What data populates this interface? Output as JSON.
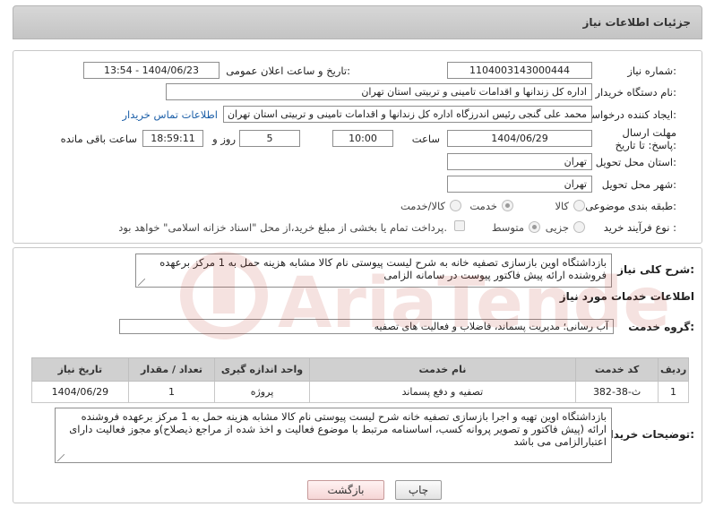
{
  "header": {
    "title": "جزئیات اطلاعات نیاز"
  },
  "form": {
    "need_number_label": "شماره نیاز:",
    "need_number": "1104003143000444",
    "announce_label": "تاریخ و ساعت اعلان عمومی:",
    "announce_value": "1404/06/23 - 13:54",
    "buyer_org_label": "نام دستگاه خریدار:",
    "buyer_org": "اداره کل زندانها و اقدامات تامینی و تربیتی استان تهران",
    "creator_label": "ایجاد کننده درخواست:",
    "creator": "محمد علی گنجی رئیس اندرزگاه  اداره کل زندانها و اقدامات تامینی و تربیتی استان تهران",
    "contact_link": "اطلاعات تماس خریدار",
    "deadline_label": "مهلت ارسال پاسخ: تا تاریخ:",
    "deadline_date": "1404/06/29",
    "time_label": "ساعت",
    "deadline_time": "10:00",
    "days_value": "5",
    "days_label": "روز و",
    "remaining_time": "18:59:11",
    "remaining_label": "ساعت باقی مانده",
    "province_label": "استان محل تحویل:",
    "province": "تهران",
    "city_label": "شهر محل تحویل:",
    "city": "تهران",
    "category_label": "طبقه بندی موضوعی:",
    "category_options": [
      "کالا",
      "خدمت",
      "کالا/خدمت"
    ],
    "category_selected": "خدمت",
    "process_label": "نوع فرآیند خرید :",
    "process_options": [
      "جزیی",
      "متوسط"
    ],
    "process_selected": "متوسط",
    "payment_note": "پرداخت تمام یا بخشی از مبلغ خرید،از محل \"اسناد خزانه اسلامی\" خواهد بود."
  },
  "description": {
    "label": "شرح کلی نیاز:",
    "text": "بازداشتگاه اوین بازسازی تصفیه خانه به شرح لیست پیوستی نام کالا مشابه هزینه حمل به 1 مرکز برعهده فروشنده ارائه پیش فاکتور  پیوست در سامانه الزامی"
  },
  "services": {
    "section_title": "اطلاعات خدمات مورد نیاز",
    "group_label": "گروه خدمت:",
    "group_value": "آب رسانی؛ مدیریت پسماند، فاضلاب و فعالیت های تصفیه",
    "columns": [
      "ردیف",
      "کد خدمت",
      "نام خدمت",
      "واحد اندازه گیری",
      "تعداد / مقدار",
      "تاریخ نیاز"
    ],
    "rows": [
      [
        "1",
        "ث-38-382",
        "تصفیه و دفع پسماند",
        "پروژه",
        "1",
        "1404/06/29"
      ]
    ]
  },
  "buyer_notes": {
    "label": "توضیحات خریدار:",
    "text": "بازداشتگاه اوین تهیه و اجرا بازسازی تصفیه خانه شرح لیست پیوستی نام کالا مشابه هزینه حمل به 1 مرکز برعهده فروشنده ارائه (پیش فاکتور و  تصویر پروانه کسب، اساسنامه مرتبط با موضوع فعالیت و اخذ شده از مراجع ذیصلاح)و مجوز فعالیت دارای اعتبارالزامی می باشد"
  },
  "buttons": {
    "print": "چاپ",
    "back": "بازگشت"
  },
  "watermark": {
    "text": "AriaTender.neT"
  }
}
